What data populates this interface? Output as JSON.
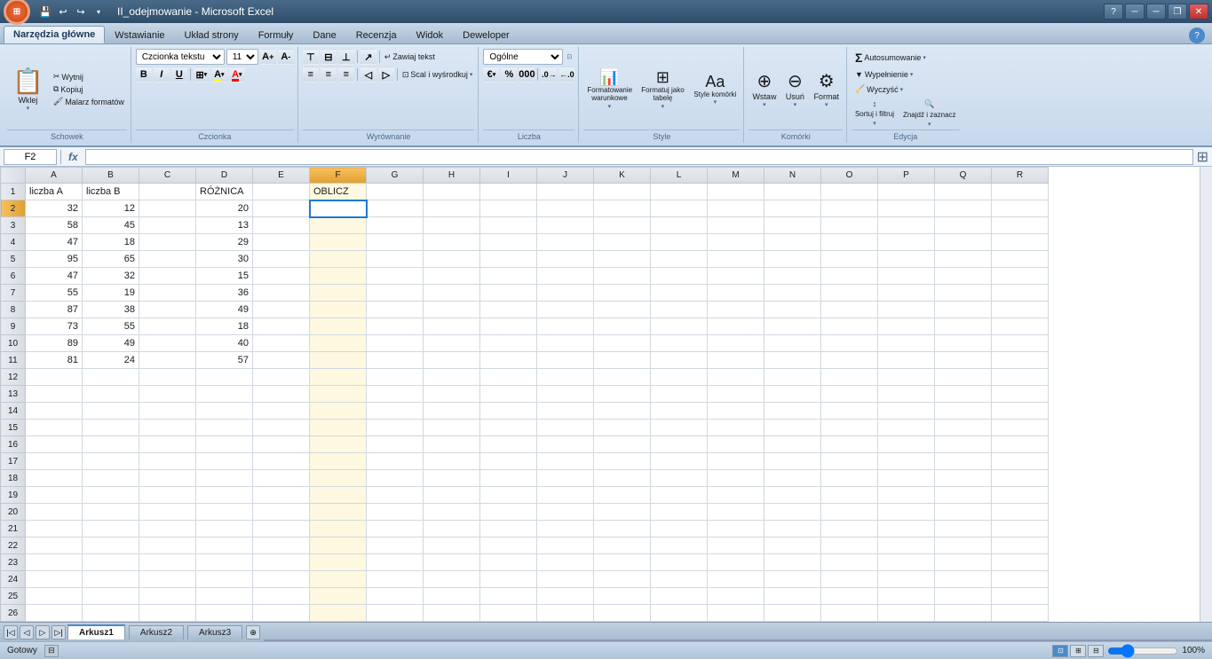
{
  "window": {
    "title": "II_odejmowanie - Microsoft Excel",
    "min_label": "─",
    "max_label": "□",
    "close_label": "✕",
    "restore_label": "❐"
  },
  "quick_access": {
    "save_label": "💾",
    "undo_label": "↩",
    "redo_label": "↪",
    "dropdown_label": "▾"
  },
  "ribbon_tabs": [
    {
      "id": "narzedzia",
      "label": "Narzędzia główne",
      "active": true
    },
    {
      "id": "wstawianie",
      "label": "Wstawianie",
      "active": false
    },
    {
      "id": "uklad",
      "label": "Układ strony",
      "active": false
    },
    {
      "id": "formuly",
      "label": "Formuły",
      "active": false
    },
    {
      "id": "dane",
      "label": "Dane",
      "active": false
    },
    {
      "id": "recenzja",
      "label": "Recenzja",
      "active": false
    },
    {
      "id": "widok",
      "label": "Widok",
      "active": false
    },
    {
      "id": "deweloper",
      "label": "Deweloper",
      "active": false
    }
  ],
  "ribbon": {
    "groups": {
      "schowek": {
        "label": "Schowek",
        "paste": "Wklej",
        "cut": "Wytnij",
        "copy": "Kopiuj",
        "format_painter": "Malarz formatów"
      },
      "czcionka": {
        "label": "Czcionka",
        "font_name": "Czcionka tekstu",
        "font_size": "11",
        "bold": "B",
        "italic": "I",
        "underline": "U",
        "borders": "⊞",
        "fill": "▼",
        "font_color": "A"
      },
      "wyrownanie": {
        "label": "Wyrównanie",
        "wrap_text": "Zawiaj tekst",
        "merge": "Scal i wyśrodkuj"
      },
      "liczba": {
        "label": "Liczba",
        "format": "Ogólne"
      },
      "style": {
        "label": "Style",
        "conditional": "Formatowanie warunkowe",
        "table": "Formatuj jako tabelę",
        "cell_styles": "Style komórki"
      },
      "komorki": {
        "label": "Komórki",
        "insert": "Wstaw",
        "delete": "Usuń",
        "format": "Format"
      },
      "edycja": {
        "label": "Edycja",
        "sum": "Autosumowanie",
        "fill": "Wypełnienie",
        "clear": "Wyczyść",
        "sort": "Sortuj i filtruj",
        "find": "Znajdź i zaznacz"
      }
    }
  },
  "formula_bar": {
    "cell_ref": "F2",
    "fx": "fx"
  },
  "columns": [
    "A",
    "B",
    "C",
    "D",
    "E",
    "F",
    "G",
    "H",
    "I",
    "J",
    "K",
    "L",
    "M",
    "N",
    "O",
    "P",
    "Q",
    "R"
  ],
  "active_col": "F",
  "active_row": 2,
  "rows": [
    {
      "row": 1,
      "A": "liczba A",
      "B": "liczba B",
      "C": "",
      "D": "RÓŻNICA",
      "E": "",
      "F": "OBLICZ",
      "G": "",
      "H": ""
    },
    {
      "row": 2,
      "A": "32",
      "B": "12",
      "C": "",
      "D": "20",
      "E": "",
      "F": "",
      "G": "",
      "H": ""
    },
    {
      "row": 3,
      "A": "58",
      "B": "45",
      "C": "",
      "D": "13",
      "E": "",
      "F": "",
      "G": "",
      "H": ""
    },
    {
      "row": 4,
      "A": "47",
      "B": "18",
      "C": "",
      "D": "29",
      "E": "",
      "F": "",
      "G": "",
      "H": ""
    },
    {
      "row": 5,
      "A": "95",
      "B": "65",
      "C": "",
      "D": "30",
      "E": "",
      "F": "",
      "G": "",
      "H": ""
    },
    {
      "row": 6,
      "A": "47",
      "B": "32",
      "C": "",
      "D": "15",
      "E": "",
      "F": "",
      "G": "",
      "H": ""
    },
    {
      "row": 7,
      "A": "55",
      "B": "19",
      "C": "",
      "D": "36",
      "E": "",
      "F": "",
      "G": "",
      "H": ""
    },
    {
      "row": 8,
      "A": "87",
      "B": "38",
      "C": "",
      "D": "49",
      "E": "",
      "F": "",
      "G": "",
      "H": ""
    },
    {
      "row": 9,
      "A": "73",
      "B": "55",
      "C": "",
      "D": "18",
      "E": "",
      "F": "",
      "G": "",
      "H": ""
    },
    {
      "row": 10,
      "A": "89",
      "B": "49",
      "C": "",
      "D": "40",
      "E": "",
      "F": "",
      "G": "",
      "H": ""
    },
    {
      "row": 11,
      "A": "81",
      "B": "24",
      "C": "",
      "D": "57",
      "E": "",
      "F": "",
      "G": "",
      "H": ""
    },
    {
      "row": 12,
      "A": "",
      "B": "",
      "C": "",
      "D": "",
      "E": "",
      "F": "",
      "G": "",
      "H": ""
    },
    {
      "row": 13,
      "A": "",
      "B": "",
      "C": "",
      "D": "",
      "E": "",
      "F": "",
      "G": "",
      "H": ""
    },
    {
      "row": 14,
      "A": "",
      "B": "",
      "C": "",
      "D": "",
      "E": "",
      "F": "",
      "G": "",
      "H": ""
    },
    {
      "row": 15,
      "A": "",
      "B": "",
      "C": "",
      "D": "",
      "E": "",
      "F": "",
      "G": "",
      "H": ""
    },
    {
      "row": 16,
      "A": "",
      "B": "",
      "C": "",
      "D": "",
      "E": "",
      "F": "",
      "G": "",
      "H": ""
    },
    {
      "row": 17,
      "A": "",
      "B": "",
      "C": "",
      "D": "",
      "E": "",
      "F": "",
      "G": "",
      "H": ""
    },
    {
      "row": 18,
      "A": "",
      "B": "",
      "C": "",
      "D": "",
      "E": "",
      "F": "",
      "G": "",
      "H": ""
    },
    {
      "row": 19,
      "A": "",
      "B": "",
      "C": "",
      "D": "",
      "E": "",
      "F": "",
      "G": "",
      "H": ""
    },
    {
      "row": 20,
      "A": "",
      "B": "",
      "C": "",
      "D": "",
      "E": "",
      "F": "",
      "G": "",
      "H": ""
    },
    {
      "row": 21,
      "A": "",
      "B": "",
      "C": "",
      "D": "",
      "E": "",
      "F": "",
      "G": "",
      "H": ""
    },
    {
      "row": 22,
      "A": "",
      "B": "",
      "C": "",
      "D": "",
      "E": "",
      "F": "",
      "G": "",
      "H": ""
    },
    {
      "row": 23,
      "A": "",
      "B": "",
      "C": "",
      "D": "",
      "E": "",
      "F": "",
      "G": "",
      "H": ""
    },
    {
      "row": 24,
      "A": "",
      "B": "",
      "C": "",
      "D": "",
      "E": "",
      "F": "",
      "G": "",
      "H": ""
    },
    {
      "row": 25,
      "A": "",
      "B": "",
      "C": "",
      "D": "",
      "E": "",
      "F": "",
      "G": "",
      "H": ""
    },
    {
      "row": 26,
      "A": "",
      "B": "",
      "C": "",
      "D": "",
      "E": "",
      "F": "",
      "G": "",
      "H": ""
    }
  ],
  "sheet_tabs": [
    {
      "label": "Arkusz1",
      "active": true
    },
    {
      "label": "Arkusz2",
      "active": false
    },
    {
      "label": "Arkusz3",
      "active": false
    }
  ],
  "status_bar": {
    "status": "Gotowy",
    "zoom": "100%"
  }
}
